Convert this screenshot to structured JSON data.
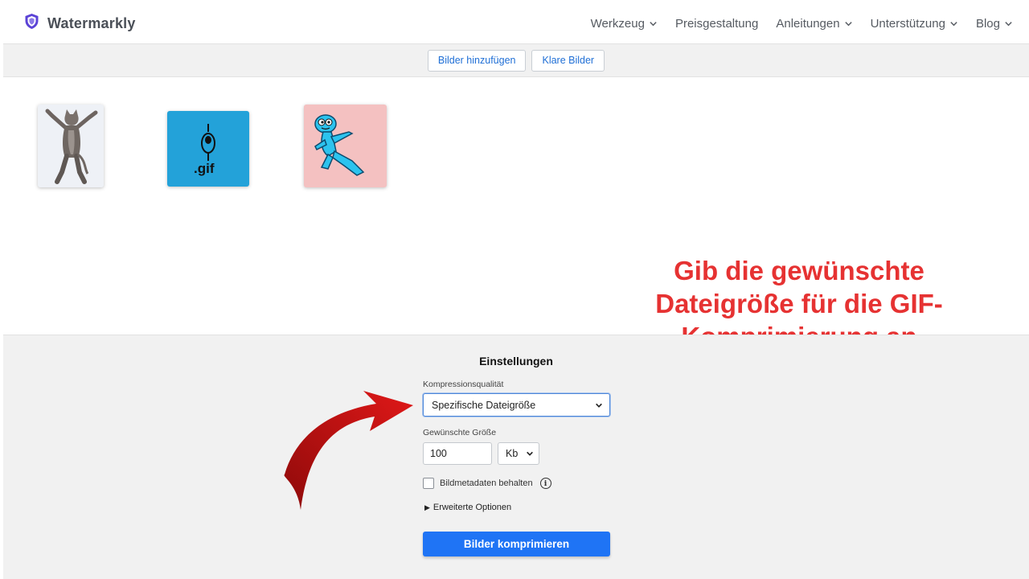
{
  "header": {
    "brand": "Watermarkly",
    "nav": [
      {
        "label": "Werkzeug",
        "dropdown": true
      },
      {
        "label": "Preisgestaltung",
        "dropdown": false
      },
      {
        "label": "Anleitungen",
        "dropdown": true
      },
      {
        "label": "Unterstützung",
        "dropdown": true
      },
      {
        "label": "Blog",
        "dropdown": true
      }
    ]
  },
  "toolbar": {
    "add_images": "Bilder hinzufügen",
    "clear_images": "Klare Bilder"
  },
  "gallery": {
    "gif_caption": ".gif"
  },
  "callout": {
    "text": "Gib die gewünschte Dateigröße für die GIF-Komprimierung an",
    "color": "#e63232"
  },
  "settings": {
    "title": "Einstellungen",
    "quality_label": "Kompressionsqualität",
    "quality_value": "Spezifische Dateigröße",
    "size_label": "Gewünschte Größe",
    "size_value": "100",
    "unit_value": "Kb",
    "metadata_label": "Bildmetadaten behalten",
    "metadata_checked": false,
    "info_icon": "info-icon",
    "advanced_label": "Erweiterte Optionen",
    "compress_button": "Bilder komprimieren"
  },
  "colors": {
    "accent": "#1f74f5",
    "link": "#1f6fd6",
    "brand_shield": "#5b43d6"
  }
}
